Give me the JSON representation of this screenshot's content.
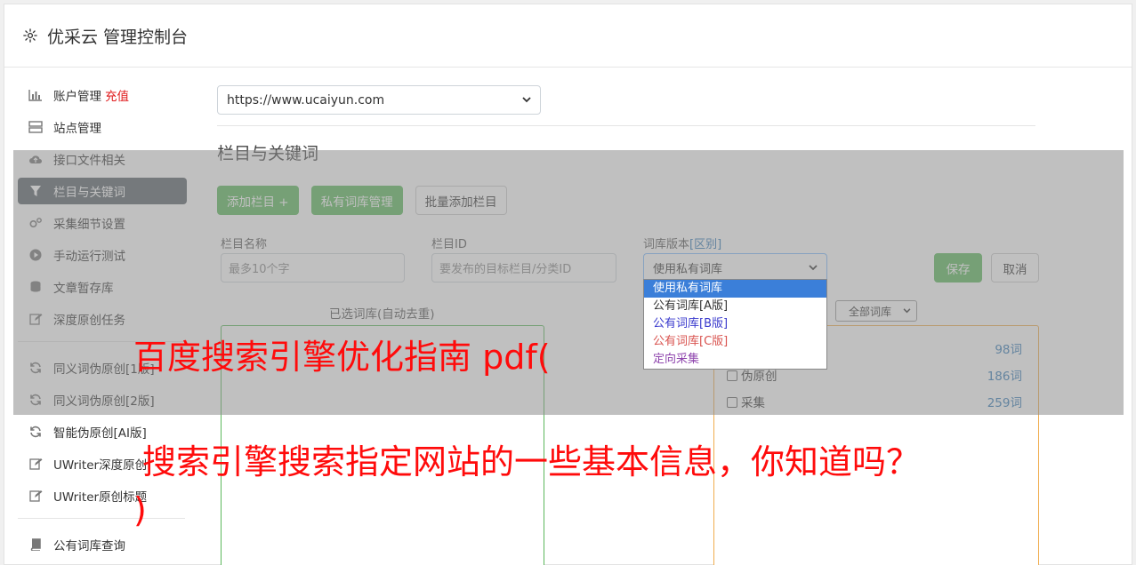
{
  "header": {
    "title": "优采云 管理控制台"
  },
  "sidebar": {
    "items": [
      {
        "label": "账户管理",
        "extra": "充值",
        "icon": "bar-chart-icon"
      },
      {
        "label": "站点管理",
        "icon": "server-icon"
      },
      {
        "label": "接口文件相关",
        "icon": "cloud-upload-icon"
      },
      {
        "label": "栏目与关键词",
        "icon": "filter-icon",
        "active": true
      },
      {
        "label": "采集细节设置",
        "icon": "gears-icon"
      },
      {
        "label": "手动运行测试",
        "icon": "play-circle-icon"
      },
      {
        "label": "文章暂存库",
        "icon": "database-icon"
      },
      {
        "label": "深度原创任务",
        "icon": "edit-icon"
      },
      {
        "label": "同义词伪原创[1版]",
        "icon": "refresh-icon"
      },
      {
        "label": "同义词伪原创[2版]",
        "icon": "refresh-icon"
      },
      {
        "label": "智能伪原创[AI版]",
        "icon": "refresh-icon"
      },
      {
        "label": "UWriter深度原创",
        "icon": "edit-icon"
      },
      {
        "label": "UWriter原创标题",
        "icon": "edit-icon"
      },
      {
        "label": "公有词库查询",
        "icon": "book-icon"
      }
    ]
  },
  "main": {
    "site_select": "https://www.ucaiyun.com",
    "section_title": "栏目与关键词",
    "buttons": {
      "add_column": "添加栏目 +",
      "private_lib": "私有词库管理",
      "batch_add": "批量添加栏目"
    },
    "form": {
      "name_label": "栏目名称",
      "name_placeholder": "最多10个字",
      "id_label": "栏目ID",
      "id_placeholder": "要发布的目标栏目/分类ID",
      "version_label": "词库版本",
      "version_link": "[区别]",
      "version_value": "使用私有词库",
      "save": "保存",
      "cancel": "取消"
    },
    "dropdown_options": [
      {
        "label": "使用私有词库",
        "color": "#ffffff",
        "selected": true
      },
      {
        "label": "公有词库[A版]",
        "color": "#333333"
      },
      {
        "label": "公有词库[B版]",
        "color": "#3a3acd"
      },
      {
        "label": "公有词库[C版]",
        "color": "#d9534f"
      },
      {
        "label": "定向采集",
        "color": "#8e44ad"
      }
    ],
    "selected_lib_title": "已选词库(自动去重)",
    "lib_filter": "全部词库",
    "libs": [
      {
        "name": "",
        "count": "98词"
      },
      {
        "name": "伪原创",
        "count": "186词"
      },
      {
        "name": "采集",
        "count": "259词"
      }
    ]
  },
  "overlay_text": {
    "line1": "百度搜索引擎优化指南 pdf(",
    "line2": "搜索引擎搜索指定网站的一些基本信息，你知道吗？",
    "line3": ")"
  }
}
